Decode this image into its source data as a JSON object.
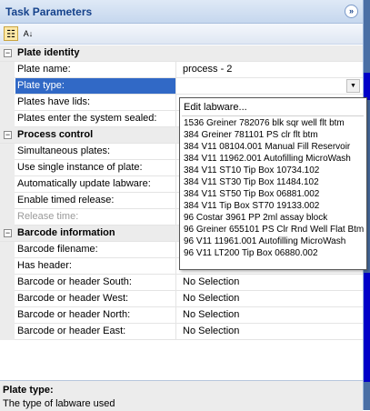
{
  "panel": {
    "title": "Task Parameters",
    "collapse_glyph": "»"
  },
  "toolbar": {
    "categorized_glyph": "☷",
    "alphabetical_glyph": "A↓"
  },
  "grid": {
    "categories": {
      "plate_identity": "Plate identity",
      "process_control": "Process control",
      "barcode_information": "Barcode information"
    },
    "plate_name_label": "Plate name:",
    "plate_name_value": "process - 2",
    "plate_type_label": "Plate type:",
    "plates_have_lids_label": "Plates have lids:",
    "plates_enter_label": "Plates enter the system sealed:",
    "simultaneous_label": "Simultaneous plates:",
    "single_instance_label": "Use single instance of plate:",
    "auto_update_label": "Automatically update labware:",
    "timed_release_label": "Enable timed release:",
    "release_time_label": "Release time:",
    "barcode_filename_label": "Barcode filename:",
    "has_header_label": "Has header:",
    "south_label": "Barcode or header South:",
    "south_value": "No Selection",
    "west_label": "Barcode or header West:",
    "west_value": "No Selection",
    "north_label": "Barcode or header North:",
    "north_value": "No Selection",
    "east_label": "Barcode or header East:",
    "east_value": "No Selection"
  },
  "dropdown": {
    "edit_label": "Edit labware...",
    "options": [
      "1536 Greiner 782076 blk sqr well flt btm",
      "384 Greiner 781101 PS clr flt btm",
      "384 V11 08104.001 Manual Fill Reservoir",
      "384 V11 11962.001 Autofilling MicroWash",
      "384 V11 ST10 Tip Box 10734.102",
      "384 V11 ST30 Tip Box 11484.102",
      "384 V11 ST50 Tip Box 06881.002",
      "384 V11 Tip Box ST70 19133.002",
      "96 Costar 3961 PP 2ml assay block",
      "96 Greiner 655101 PS Clr Rnd Well Flat Btm",
      "96 V11 11961.001 Autofilling MicroWash",
      "96 V11 LT200 Tip Box 06880.002"
    ]
  },
  "description": {
    "title": "Plate type:",
    "text": "The type of labware used"
  },
  "colors": {
    "title_text": "#15428b",
    "selection": "#3169c6",
    "category_bg": "#ececec"
  }
}
